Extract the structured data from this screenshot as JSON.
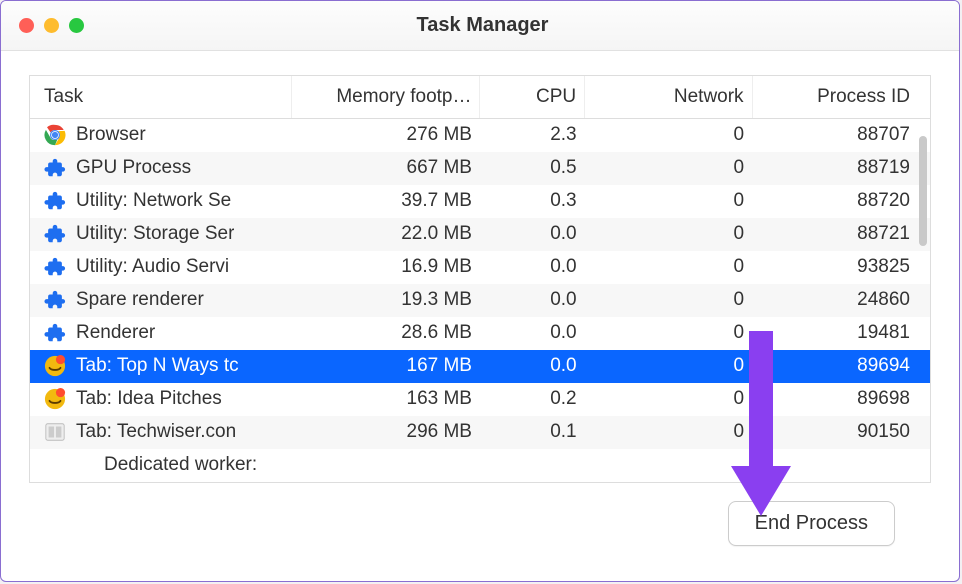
{
  "window": {
    "title": "Task Manager"
  },
  "columns": {
    "task": "Task",
    "memory": "Memory footp…",
    "cpu": "CPU",
    "network": "Network",
    "pid": "Process ID"
  },
  "rows": [
    {
      "icon": "chrome",
      "task": "Browser",
      "memory": "276 MB",
      "cpu": "2.3",
      "network": "0",
      "pid": "88707",
      "alt": false,
      "sel": false,
      "indent": false
    },
    {
      "icon": "puzzle",
      "task": "GPU Process",
      "memory": "667 MB",
      "cpu": "0.5",
      "network": "0",
      "pid": "88719",
      "alt": true,
      "sel": false,
      "indent": false
    },
    {
      "icon": "puzzle",
      "task": "Utility: Network Se",
      "memory": "39.7 MB",
      "cpu": "0.3",
      "network": "0",
      "pid": "88720",
      "alt": false,
      "sel": false,
      "indent": false
    },
    {
      "icon": "puzzle",
      "task": "Utility: Storage Ser",
      "memory": "22.0 MB",
      "cpu": "0.0",
      "network": "0",
      "pid": "88721",
      "alt": true,
      "sel": false,
      "indent": false
    },
    {
      "icon": "puzzle",
      "task": "Utility: Audio Servi",
      "memory": "16.9 MB",
      "cpu": "0.0",
      "network": "0",
      "pid": "93825",
      "alt": false,
      "sel": false,
      "indent": false
    },
    {
      "icon": "puzzle",
      "task": "Spare renderer",
      "memory": "19.3 MB",
      "cpu": "0.0",
      "network": "0",
      "pid": "24860",
      "alt": true,
      "sel": false,
      "indent": false
    },
    {
      "icon": "puzzle",
      "task": "Renderer",
      "memory": "28.6 MB",
      "cpu": "0.0",
      "network": "0",
      "pid": "19481",
      "alt": false,
      "sel": false,
      "indent": false
    },
    {
      "icon": "favicon1",
      "task": "Tab: Top N Ways tc",
      "memory": "167 MB",
      "cpu": "0.0",
      "network": "0",
      "pid": "89694",
      "alt": false,
      "sel": true,
      "indent": false
    },
    {
      "icon": "favicon1",
      "task": "Tab: Idea Pitches",
      "memory": "163 MB",
      "cpu": "0.2",
      "network": "0",
      "pid": "89698",
      "alt": false,
      "sel": false,
      "indent": false
    },
    {
      "icon": "favicon2",
      "task": "Tab: Techwiser.con",
      "memory": "296 MB",
      "cpu": "0.1",
      "network": "0",
      "pid": "90150",
      "alt": true,
      "sel": false,
      "indent": false
    },
    {
      "icon": "none",
      "task": "Dedicated worker:",
      "memory": "",
      "cpu": "",
      "network": "",
      "pid": "",
      "alt": false,
      "sel": false,
      "indent": true
    }
  ],
  "footer": {
    "end_process": "End Process"
  },
  "annotation": {
    "arrow_color": "#8a3ff0"
  }
}
